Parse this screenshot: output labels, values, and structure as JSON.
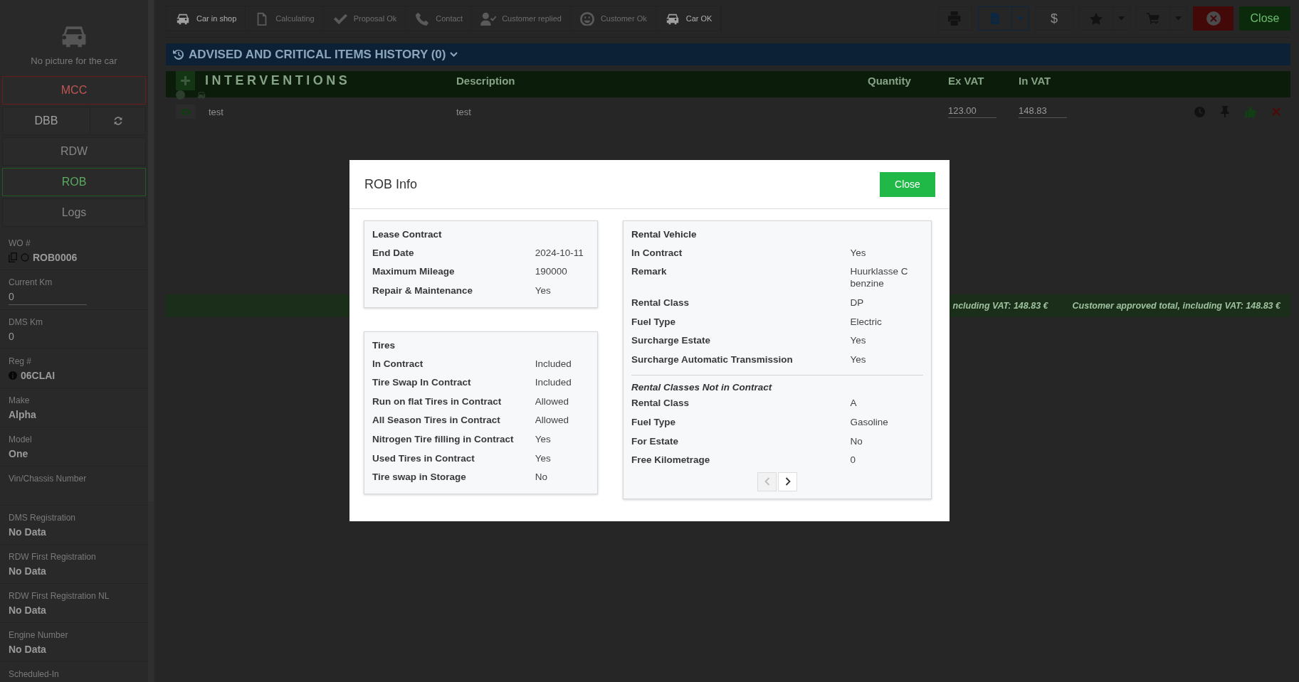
{
  "toolbar": {
    "steps": [
      {
        "label": "Car in shop",
        "active": true,
        "kind": "car"
      },
      {
        "label": "Calculating",
        "active": false,
        "kind": "document"
      },
      {
        "label": "Proposal Ok",
        "active": false,
        "kind": "check"
      },
      {
        "label": "Contact",
        "active": false,
        "kind": "phone"
      },
      {
        "label": "Customer replied",
        "active": false,
        "kind": "user"
      },
      {
        "label": "Customer Ok",
        "active": false,
        "kind": "smile"
      },
      {
        "label": "Car OK",
        "active": true,
        "kind": "car"
      }
    ],
    "currency_symbol": "$",
    "close_label": "Close"
  },
  "sidebar": {
    "photo_caption": "No picture for the car",
    "buttons": [
      {
        "label": "MCC",
        "kind": "alert"
      },
      {
        "label": "DBB",
        "kind": "refresh"
      },
      {
        "label": "RDW",
        "kind": "plain"
      },
      {
        "label": "ROB",
        "kind": "success"
      },
      {
        "label": "Logs",
        "kind": "plain"
      }
    ],
    "fields": [
      {
        "label": "WO #",
        "value": "ROB0006",
        "kind": "wo"
      },
      {
        "label": "Current Km",
        "value": "0",
        "kind": "input"
      },
      {
        "label": "DMS Km",
        "value": "0",
        "kind": "plain"
      },
      {
        "label": "Reg #",
        "value": "06CLAI",
        "kind": "info"
      },
      {
        "label": "Make",
        "value": "Alpha",
        "kind": "bold"
      },
      {
        "label": "Model",
        "value": "One",
        "kind": "bold"
      },
      {
        "label": "Vin/Chassis Number"
      },
      {
        "label": "DMS Registration",
        "value": "No Data",
        "kind": "bold"
      },
      {
        "label": "RDW First Registration",
        "value": "No Data",
        "kind": "bold"
      },
      {
        "label": "RDW First Registration NL",
        "value": "No Data",
        "kind": "bold"
      },
      {
        "label": "Engine Number",
        "value": "No Data",
        "kind": "bold"
      },
      {
        "label": "Scheduled-In"
      }
    ]
  },
  "advised": {
    "title": "ADVISED AND CRITICAL ITEMS HISTORY (0)"
  },
  "interventions": {
    "title": "INTERVENTIONS",
    "columns": [
      "Description",
      "Quantity",
      "Ex VAT",
      "In VAT"
    ],
    "rows": [
      {
        "name": "test",
        "description": "test",
        "ex_vat": "123.00",
        "in_vat": "148.83"
      }
    ]
  },
  "totals": [
    "ncluding VAT: 148.83 €",
    "Customer approved total, including VAT: 148.83 €"
  ],
  "modal": {
    "title": "ROB Info",
    "close_label": "Close",
    "lease": {
      "title": "Lease Contract",
      "rows": [
        {
          "label": "End Date",
          "value": "2024-10-11"
        },
        {
          "label": "Maximum Mileage",
          "value": "190000"
        },
        {
          "label": "Repair & Maintenance",
          "value": "Yes"
        }
      ]
    },
    "tires": {
      "title": "Tires",
      "rows": [
        {
          "label": "In Contract",
          "value": "Included"
        },
        {
          "label": "Tire Swap In Contract",
          "value": "Included"
        },
        {
          "label": "Run on flat Tires in Contract",
          "value": "Allowed"
        },
        {
          "label": "All Season Tires in Contract",
          "value": "Allowed"
        },
        {
          "label": "Nitrogen Tire filling in Contract",
          "value": "Yes"
        },
        {
          "label": "Used Tires in Contract",
          "value": "Yes"
        },
        {
          "label": "Tire swap in Storage",
          "value": "No"
        }
      ]
    },
    "rental": {
      "title": "Rental Vehicle",
      "rows": [
        {
          "label": "In Contract",
          "value": "Yes"
        },
        {
          "label": "Remark",
          "value": "Huurklasse C benzine"
        },
        {
          "label": "Rental Class",
          "value": "DP"
        },
        {
          "label": "Fuel Type",
          "value": "Electric"
        },
        {
          "label": "Surcharge Estate",
          "value": "Yes"
        },
        {
          "label": "Surcharge Automatic Transmission",
          "value": "Yes"
        }
      ],
      "subheading": "Rental Classes Not in Contract",
      "sub_rows": [
        {
          "label": "Rental Class",
          "value": "A"
        },
        {
          "label": "Fuel Type",
          "value": "Gasoline"
        },
        {
          "label": "For Estate",
          "value": "No"
        },
        {
          "label": "Free Kilometrage",
          "value": "0"
        }
      ],
      "pager": {
        "previous_disabled": true,
        "next_disabled": false
      }
    }
  }
}
